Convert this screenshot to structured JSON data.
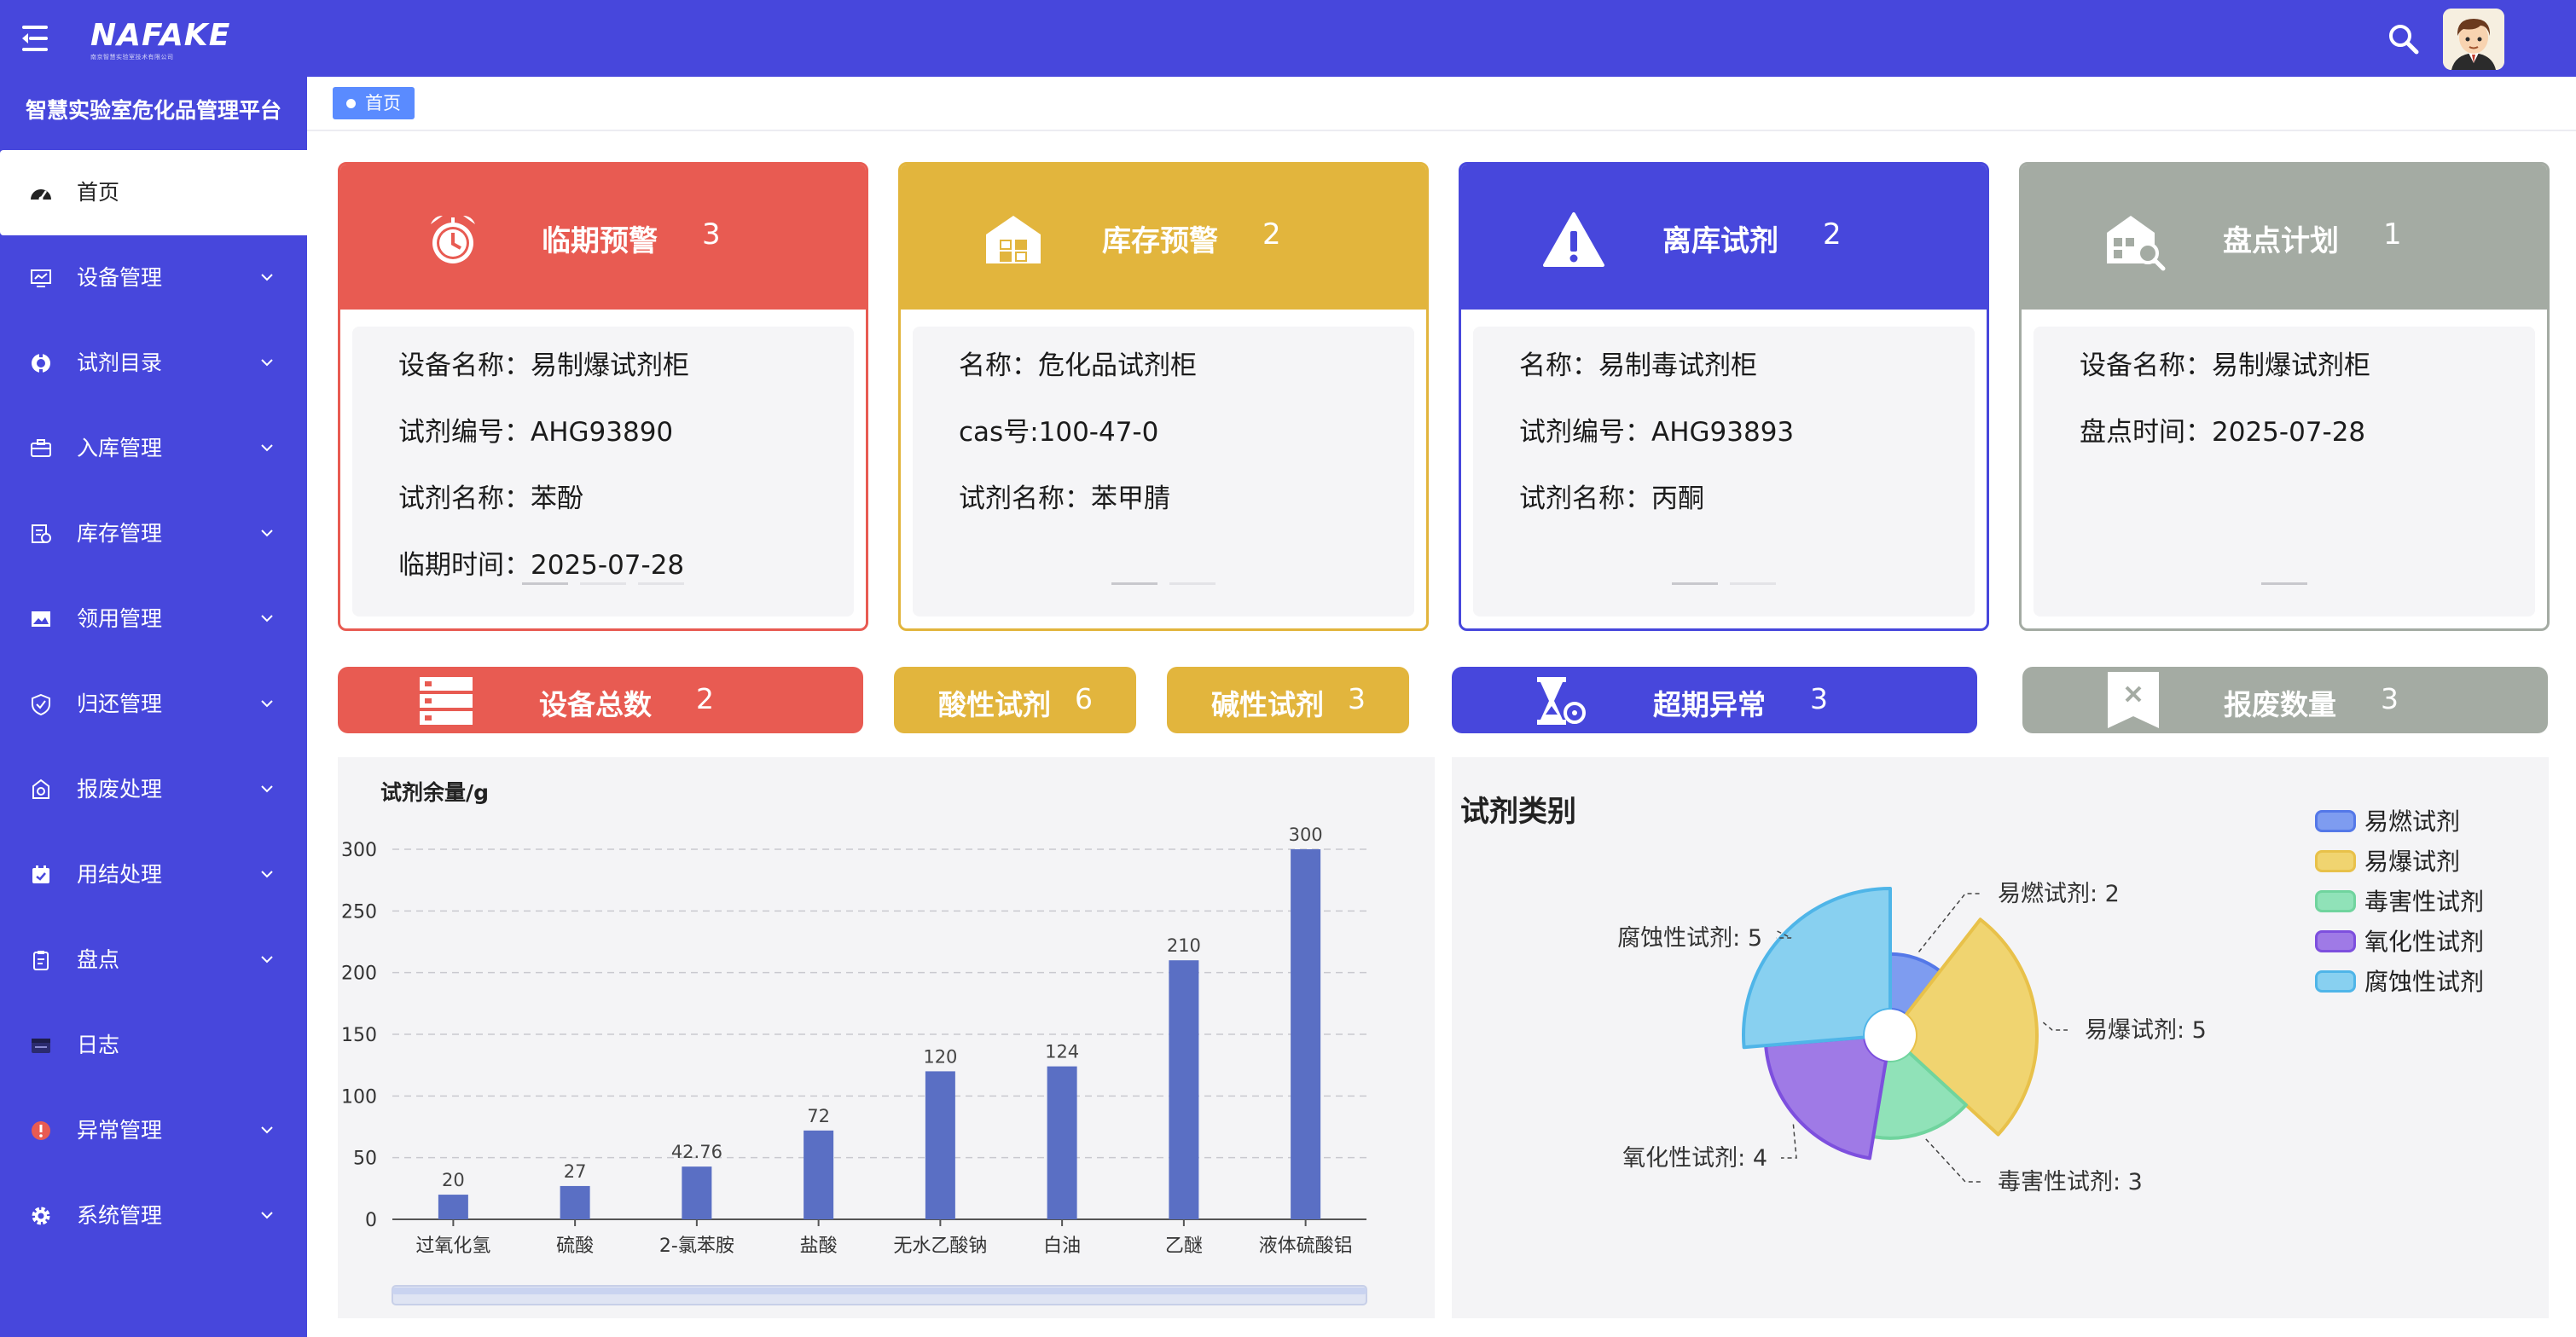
{
  "app": {
    "logo_text": "NAFAKE",
    "logo_sub": "南京智慧实验室技术有限公司",
    "brand": "智慧实验室危化品管理平台"
  },
  "colors": {
    "primary": "#4747dc",
    "red": "#e85b52",
    "yellow": "#e2b53d",
    "blue": "#4747dc",
    "gray": "#a4aba3",
    "bar": "#5a6fc4"
  },
  "icons": {
    "menu": "menu-icon",
    "search": "search-icon",
    "alarm": "alarm-clock-icon",
    "warehouse": "warehouse-icon",
    "warning": "warning-icon",
    "inventory": "inventory-search-icon",
    "server": "server-icon",
    "hourglass": "hourglass-icon",
    "scrap": "scrap-bookmark-icon"
  },
  "sidebar": {
    "items": [
      {
        "label": "首页",
        "icon": "dashboard-icon"
      },
      {
        "label": "设备管理",
        "icon": "monitor-icon"
      },
      {
        "label": "试剂目录",
        "icon": "catalog-icon"
      },
      {
        "label": "入库管理",
        "icon": "inbound-icon"
      },
      {
        "label": "库存管理",
        "icon": "stock-icon"
      },
      {
        "label": "领用管理",
        "icon": "picture-icon"
      },
      {
        "label": "归还管理",
        "icon": "shield-icon"
      },
      {
        "label": "报废处理",
        "icon": "scrap-icon"
      },
      {
        "label": "用结处理",
        "icon": "calendar-icon"
      },
      {
        "label": "盘点",
        "icon": "clipboard-icon"
      },
      {
        "label": "日志",
        "icon": "log-icon"
      },
      {
        "label": "异常管理",
        "icon": "alert-icon"
      },
      {
        "label": "系统管理",
        "icon": "gear-icon"
      }
    ]
  },
  "breadcrumb": {
    "label": "首页"
  },
  "cards": [
    {
      "title": "临期预警",
      "count": "3",
      "lines": [
        "设备名称：易制爆试剂柜",
        "试剂编号：AHG93890",
        "试剂名称：苯酚",
        "临期时间：2025-07-28"
      ]
    },
    {
      "title": "库存预警",
      "count": "2",
      "lines": [
        "名称：危化品试剂柜",
        "cas号:100-47-0",
        "试剂名称：苯甲腈"
      ]
    },
    {
      "title": "离库试剂",
      "count": "2",
      "lines": [
        "名称：易制毒试剂柜",
        "试剂编号：AHG93893",
        "试剂名称：丙酮"
      ]
    },
    {
      "title": "盘点计划",
      "count": "1",
      "lines": [
        "设备名称：易制爆试剂柜",
        "盘点时间：2025-07-28"
      ]
    }
  ],
  "stats": [
    {
      "title": "设备总数",
      "count": "2"
    },
    {
      "title": "酸性试剂",
      "count": "6"
    },
    {
      "title": "碱性试剂",
      "count": "3"
    },
    {
      "title": "超期异常",
      "count": "3"
    },
    {
      "title": "报废数量",
      "count": "3"
    }
  ],
  "chart_data": [
    {
      "type": "bar",
      "ylabel": "试剂余量/g",
      "categories": [
        "过氧化氢",
        "硫酸",
        "2-氯苯胺",
        "盐酸",
        "无水乙酸钠",
        "白油",
        "乙醚",
        "液体硫酸铝"
      ],
      "values": [
        20,
        27,
        42.76,
        72,
        120,
        124,
        210,
        300
      ],
      "value_labels": [
        "20",
        "27",
        "42.76",
        "72",
        "120",
        "124",
        "210",
        "300"
      ],
      "ylim": [
        0,
        300
      ],
      "yticks": [
        "0",
        "50",
        "100",
        "150",
        "200",
        "250",
        "300"
      ],
      "grid": true
    },
    {
      "type": "pie",
      "variant": "rose",
      "title": "试剂类别",
      "legend_position": "top-right",
      "slices": [
        {
          "name": "易燃试剂",
          "value": 2,
          "label": "易燃试剂: 2",
          "color": "#7e9cf0",
          "stroke": "#5478e8"
        },
        {
          "name": "易爆试剂",
          "value": 5,
          "label": "易爆试剂: 5",
          "color": "#f0d470",
          "stroke": "#e8c14a"
        },
        {
          "name": "毒害性试剂",
          "value": 3,
          "label": "毒害性试剂: 3",
          "color": "#90e2b8",
          "stroke": "#70d49e"
        },
        {
          "name": "氧化性试剂",
          "value": 4,
          "label": "氧化性试剂: 4",
          "color": "#9f7ae6",
          "stroke": "#7d4fde"
        },
        {
          "name": "腐蚀性试剂",
          "value": 5,
          "label": "腐蚀性试剂: 5",
          "color": "#88d0f0",
          "stroke": "#4fb5e8"
        }
      ]
    }
  ]
}
